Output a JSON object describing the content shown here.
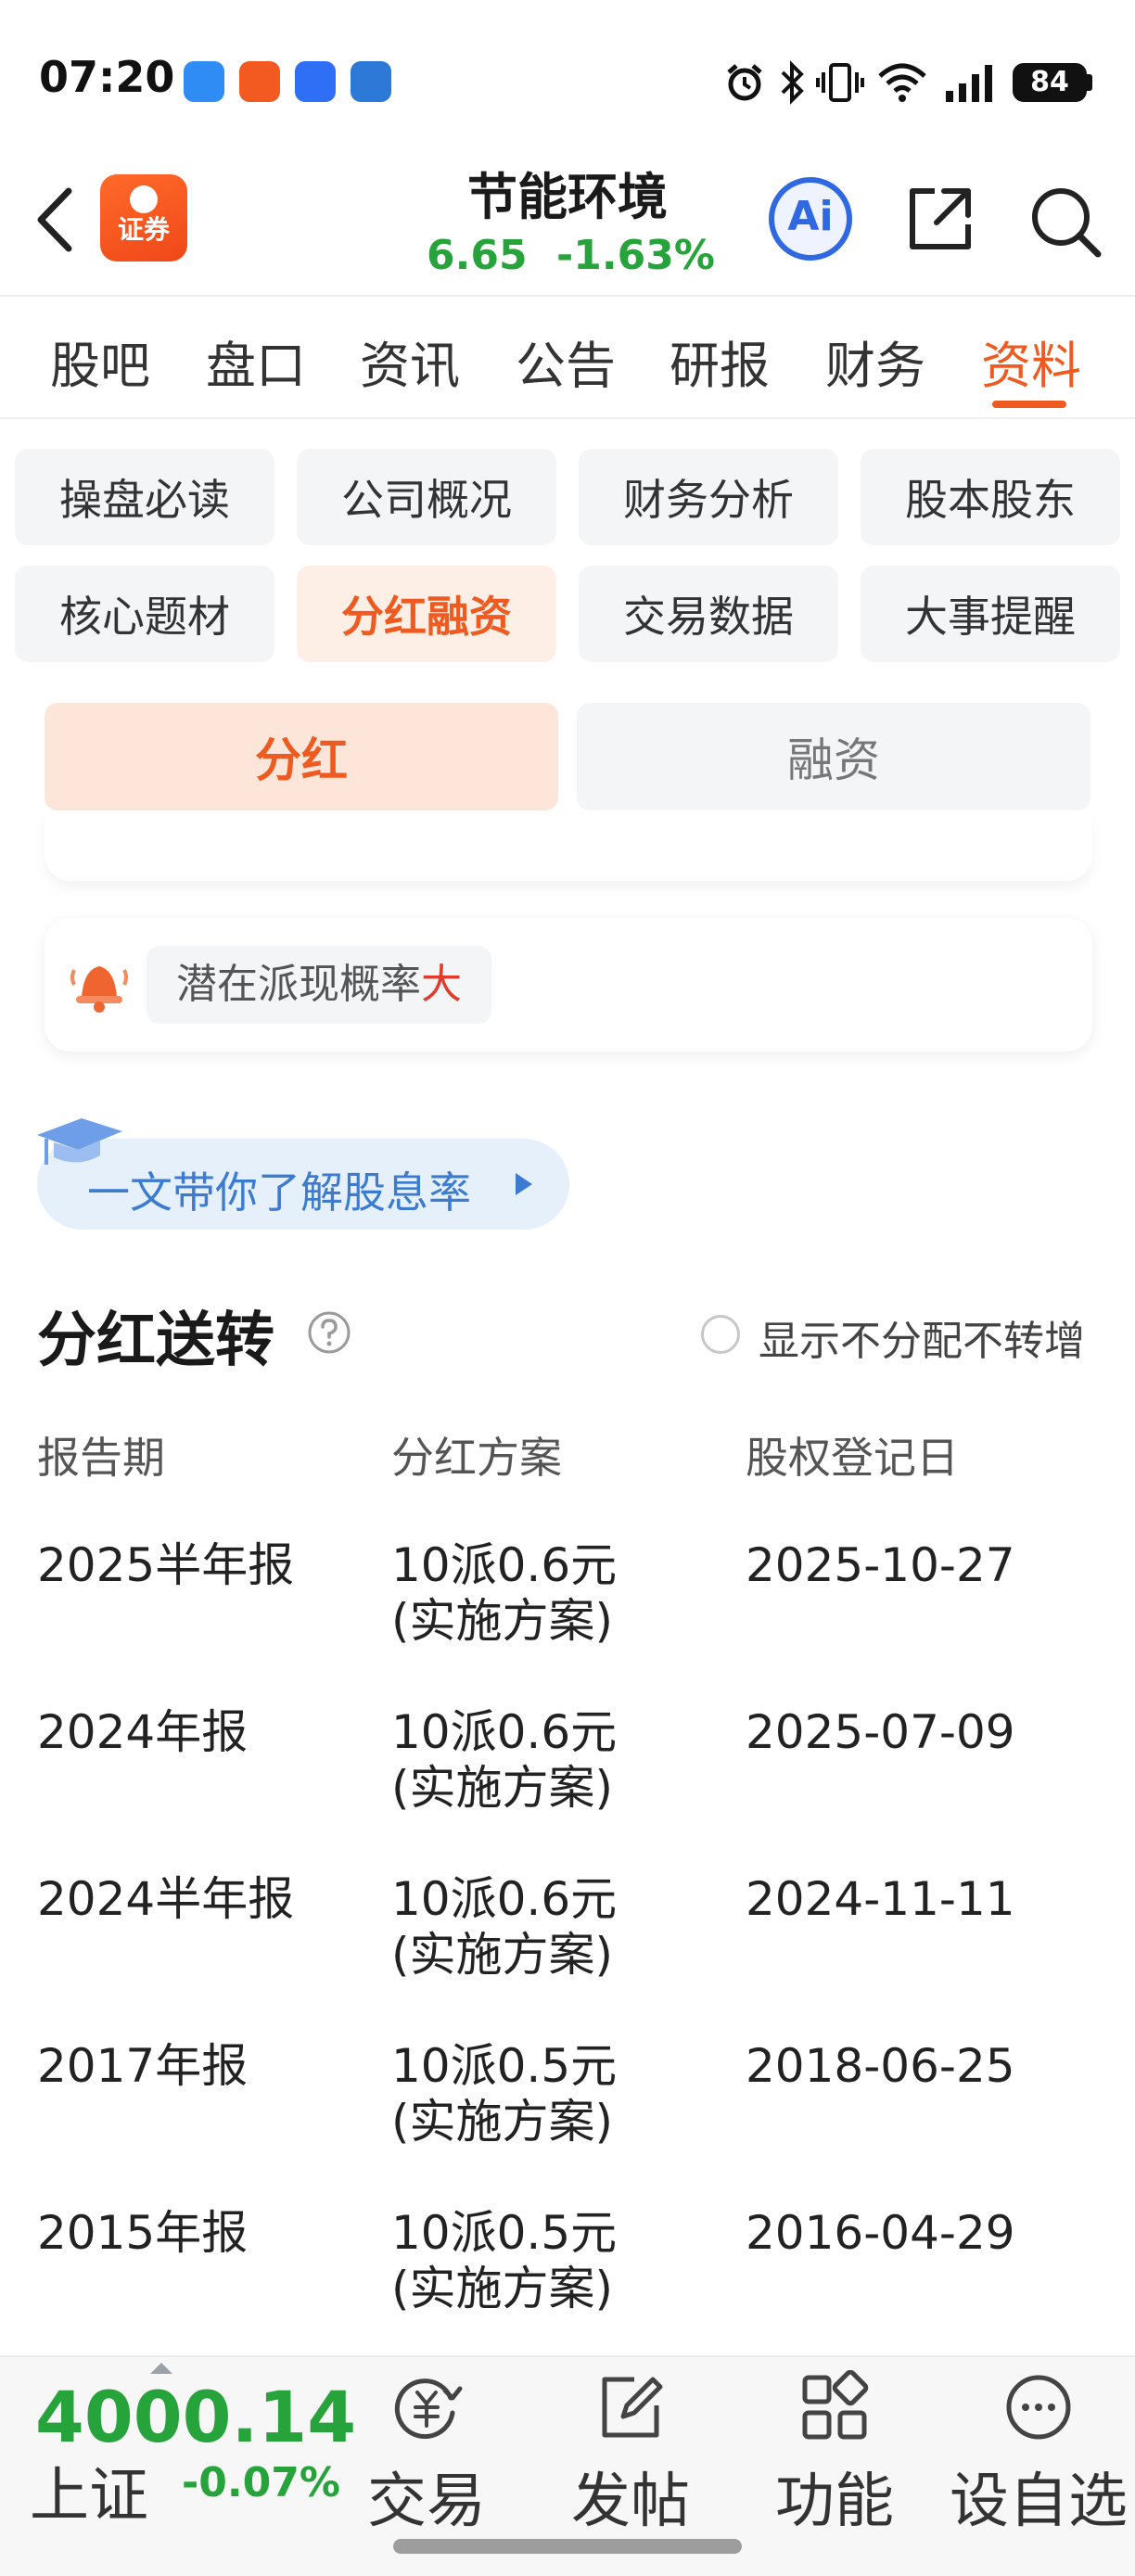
{
  "status_bar": {
    "time": "07:20",
    "battery": "84",
    "icons": [
      "alarm-icon",
      "bluetooth-icon",
      "vibrate-icon",
      "wifi-icon",
      "signal-icon",
      "battery-icon"
    ]
  },
  "header": {
    "brand_label": "证券",
    "stock_name": "节能环境",
    "price": "6.65",
    "change": "-1.63%",
    "ai_label": "Ai"
  },
  "tabs": [
    {
      "label": "股吧"
    },
    {
      "label": "盘口"
    },
    {
      "label": "资讯"
    },
    {
      "label": "公告"
    },
    {
      "label": "研报"
    },
    {
      "label": "财务"
    },
    {
      "label": "资料",
      "active": true
    }
  ],
  "subcategories": [
    {
      "label": "操盘必读"
    },
    {
      "label": "公司概况"
    },
    {
      "label": "财务分析"
    },
    {
      "label": "股本股东"
    },
    {
      "label": "核心题材"
    },
    {
      "label": "分红融资",
      "active": true
    },
    {
      "label": "交易数据"
    },
    {
      "label": "大事提醒"
    }
  ],
  "segment": {
    "active": "分红",
    "inactive": "融资"
  },
  "alert": {
    "text": "潜在派现概率",
    "highlight": "大"
  },
  "learn_banner": {
    "text": "一文带你了解股息率"
  },
  "dividend_section": {
    "title": "分红送转",
    "toggle_label": "显示不分配不转增",
    "columns": [
      "报告期",
      "分红方案",
      "股权登记日"
    ],
    "rows": [
      {
        "period": "2025半年报",
        "plan": "10派0.6元",
        "status": "(实施方案)",
        "date": "2025-10-27"
      },
      {
        "period": "2024年报",
        "plan": "10派0.6元",
        "status": "(实施方案)",
        "date": "2025-07-09"
      },
      {
        "period": "2024半年报",
        "plan": "10派0.6元",
        "status": "(实施方案)",
        "date": "2024-11-11"
      },
      {
        "period": "2017年报",
        "plan": "10派0.5元",
        "status": "(实施方案)",
        "date": "2018-06-25"
      },
      {
        "period": "2015年报",
        "plan": "10派0.5元",
        "status": "(实施方案)",
        "date": "2016-04-29"
      }
    ]
  },
  "bottom_bar": {
    "index_value": "4000.14",
    "index_name": "上证",
    "index_change": "-0.07%",
    "nav": [
      {
        "label": "交易",
        "icon": "trade-icon"
      },
      {
        "label": "发帖",
        "icon": "post-icon"
      },
      {
        "label": "功能",
        "icon": "apps-icon"
      },
      {
        "label": "设自选",
        "icon": "more-icon"
      }
    ]
  },
  "colors": {
    "accent": "#ee5a1f",
    "down": "#27a33c",
    "link": "#3d7bd1",
    "highlight": "#e23b2c"
  }
}
